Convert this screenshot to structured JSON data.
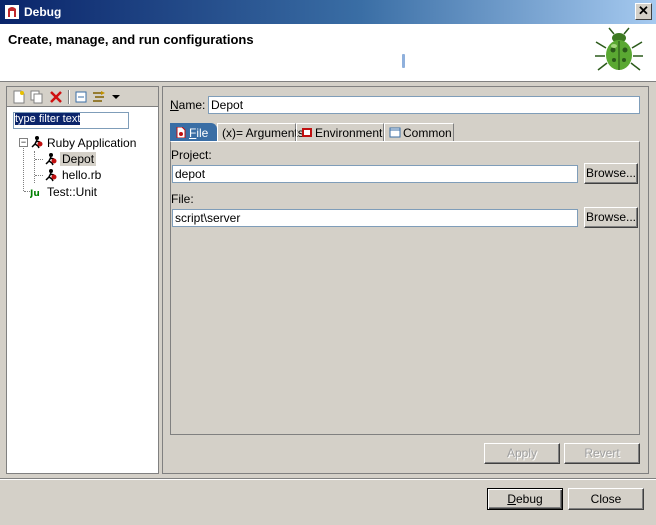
{
  "window": {
    "title": "Debug",
    "close_glyph": "✕"
  },
  "banner": {
    "heading": "Create, manage, and run configurations",
    "icon": "bug-icon"
  },
  "left": {
    "toolbar": {
      "icons": [
        "new-config-icon",
        "duplicate-icon",
        "delete-icon",
        "collapse-all-icon",
        "filter-icon",
        "view-menu-icon"
      ]
    },
    "filter": {
      "text": "type filter text"
    },
    "tree": {
      "ruby_app": {
        "label": "Ruby Application",
        "expander": "−"
      },
      "depot": {
        "label": "Depot"
      },
      "hello": {
        "label": "hello.rb"
      },
      "testunit": {
        "label": "Test::Unit"
      }
    }
  },
  "right": {
    "name_label_prefix": "N",
    "name_label_rest": "ame:",
    "name_value": "Depot",
    "tabs": [
      {
        "label_u": "F",
        "label_rest": "ile",
        "icon": "file-icon"
      },
      {
        "label_u": "",
        "label_rest": "(x)= Arguments",
        "icon": "arguments-icon"
      },
      {
        "label_u": "",
        "label_rest": "Environment",
        "icon": "environment-icon"
      },
      {
        "label_u": "",
        "label_rest": "Common",
        "icon": "common-icon"
      }
    ],
    "project_label": "Project:",
    "project_value": "depot",
    "file_label": "File:",
    "file_value": "script\\server",
    "browse_label": "Browse...",
    "apply_label": "Apply",
    "revert_label": "Revert"
  },
  "footer": {
    "debug_label_u": "D",
    "debug_label_rest": "ebug",
    "close_label": "Close"
  }
}
